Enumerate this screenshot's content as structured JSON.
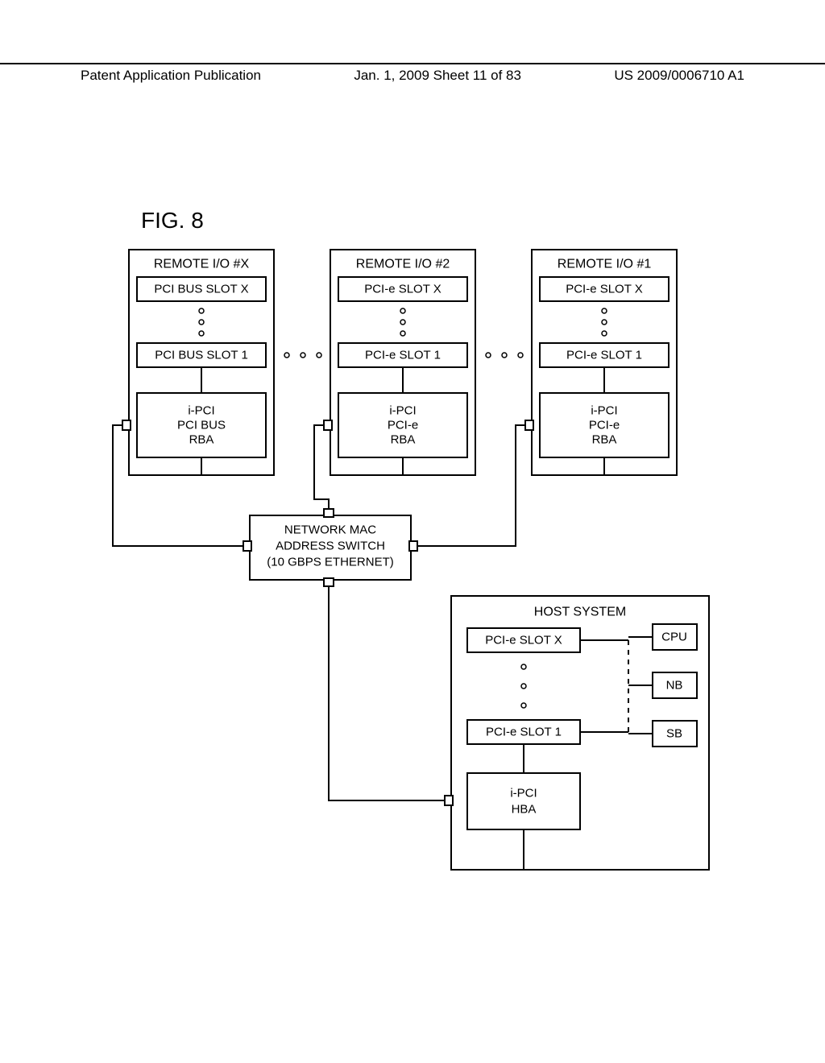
{
  "header": {
    "left": "Patent Application Publication",
    "center": "Jan. 1, 2009  Sheet 11 of 83",
    "right": "US 2009/0006710 A1"
  },
  "figure_label": "FIG. 8",
  "remote_x": {
    "title": "REMOTE I/O #X",
    "slot_x": "PCI BUS SLOT X",
    "slot_1": "PCI BUS SLOT 1",
    "rba1": "i-PCI",
    "rba2": "PCI BUS",
    "rba3": "RBA"
  },
  "remote_2": {
    "title": "REMOTE I/O #2",
    "slot_x": "PCI-e SLOT X",
    "slot_1": "PCI-e SLOT 1",
    "rba1": "i-PCI",
    "rba2": "PCI-e",
    "rba3": "RBA"
  },
  "remote_1": {
    "title": "REMOTE I/O #1",
    "slot_x": "PCI-e SLOT X",
    "slot_1": "PCI-e SLOT 1",
    "rba1": "i-PCI",
    "rba2": "PCI-e",
    "rba3": "RBA"
  },
  "switch": {
    "l1": "NETWORK MAC",
    "l2": "ADDRESS SWITCH",
    "l3": "(10 GBPS ETHERNET)"
  },
  "host": {
    "title": "HOST SYSTEM",
    "slot_x": "PCI-e SLOT X",
    "slot_1": "PCI-e SLOT 1",
    "cpu": "CPU",
    "nb": "NB",
    "sb": "SB",
    "hba1": "i-PCI",
    "hba2": "HBA"
  }
}
